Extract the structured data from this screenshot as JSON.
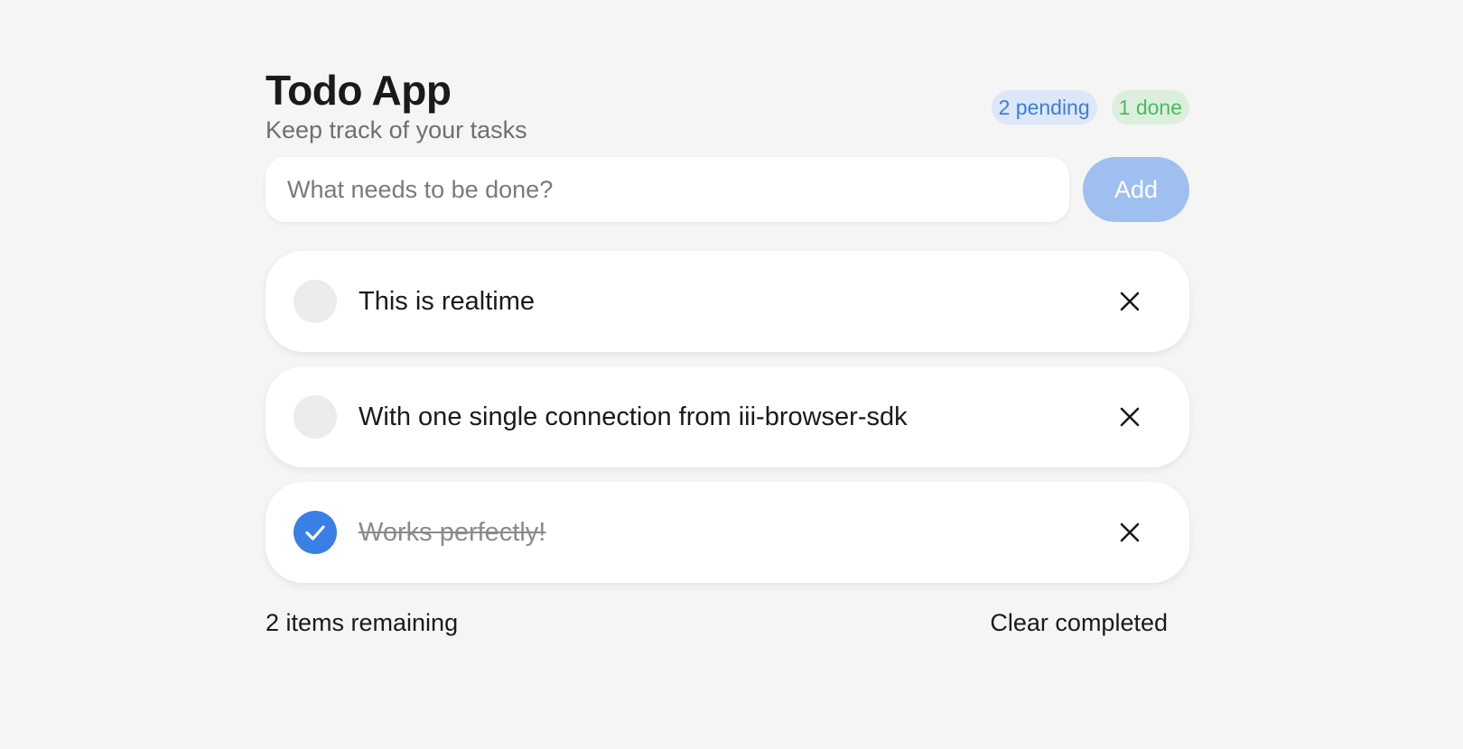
{
  "header": {
    "title": "Todo App",
    "subtitle": "Keep track of your tasks",
    "pending_badge": "2 pending",
    "done_badge": "1 done"
  },
  "add_form": {
    "input_value": "",
    "input_placeholder": "What needs to be done?",
    "add_label": "Add"
  },
  "todos": [
    {
      "text": "This is realtime",
      "completed": false,
      "check_icon": "empty-circle",
      "delete_icon": "close-icon"
    },
    {
      "text": "With one single connection from iii-browser-sdk",
      "completed": false,
      "check_icon": "empty-circle",
      "delete_icon": "close-icon"
    },
    {
      "text": "Works perfectly!",
      "completed": true,
      "check_icon": "checkmark-icon",
      "delete_icon": "close-icon"
    }
  ],
  "footer": {
    "remaining_text": "2 items remaining",
    "clear_label": "Clear completed"
  },
  "colors": {
    "background": "#f5f5f5",
    "accent": "#3a7fe6",
    "add_button": "#9ebff0",
    "pending_badge_bg": "#dde7f8",
    "pending_badge_text": "#3b7de0",
    "done_badge_bg": "#dcefdf",
    "done_badge_text": "#4cbb5c"
  }
}
